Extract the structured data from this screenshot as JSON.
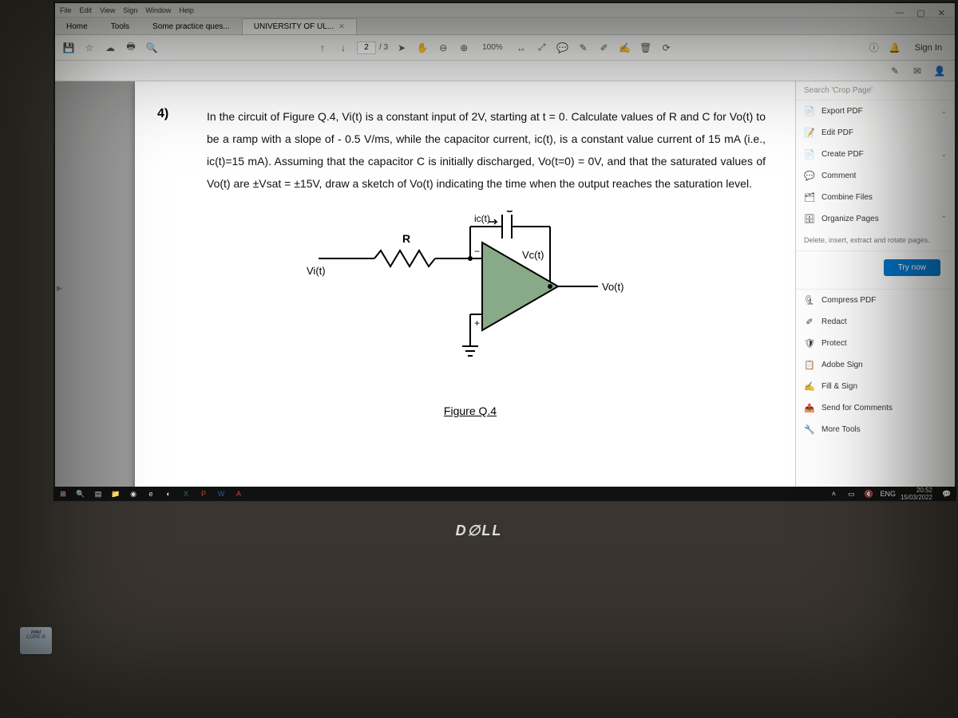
{
  "menubar": [
    "File",
    "Edit",
    "View",
    "Sign",
    "Window",
    "Help"
  ],
  "tabs": {
    "home": "Home",
    "tools": "Tools",
    "doc1": "Some practice ques...",
    "doc2": "UNIVERSITY OF UL..."
  },
  "toolbar": {
    "page_current": "2",
    "page_total": "/ 3",
    "zoom": "100%",
    "signin": "Sign In"
  },
  "question": {
    "num": "4)",
    "text": "In the circuit of Figure Q.4, Vi(t) is a constant input of 2V, starting at t = 0. Calculate values of R and C for Vo(t) to be a ramp with a slope of  - 0.5 V/ms, while the capacitor current, ic(t), is a constant value current of 15 mA (i.e., ic(t)=15 mA). Assuming that the capacitor C is initially discharged, Vo(t=0) = 0V, and that the saturated values of Vo(t) are ±Vsat = ±15V, draw a sketch of Vo(t) indicating the time when the output reaches the saturation level."
  },
  "figure": {
    "caption": "Figure Q.4",
    "labels": {
      "R": "R",
      "C": "C",
      "Vi": "Vi(t)",
      "Vc": "Vc(t)",
      "Vo": "Vo(t)",
      "ic": "ic(t)"
    }
  },
  "panel": {
    "search_placeholder": "Search 'Crop Page'",
    "items": [
      "Export PDF",
      "Edit PDF",
      "Create PDF",
      "Comment",
      "Combine Files",
      "Organize Pages"
    ],
    "promo": "Delete, insert, extract and rotate pages.",
    "try": "Try now",
    "items2": [
      "Compress PDF",
      "Redact",
      "Protect",
      "Adobe Sign",
      "Fill & Sign",
      "Send for Comments",
      "More Tools"
    ]
  },
  "taskbar": {
    "lang": "ENG",
    "time": "20:52",
    "date": "15/03/2022"
  },
  "brand": {
    "dell": "D∅LL",
    "sticker1": "intel",
    "sticker2": "CORE i5"
  }
}
